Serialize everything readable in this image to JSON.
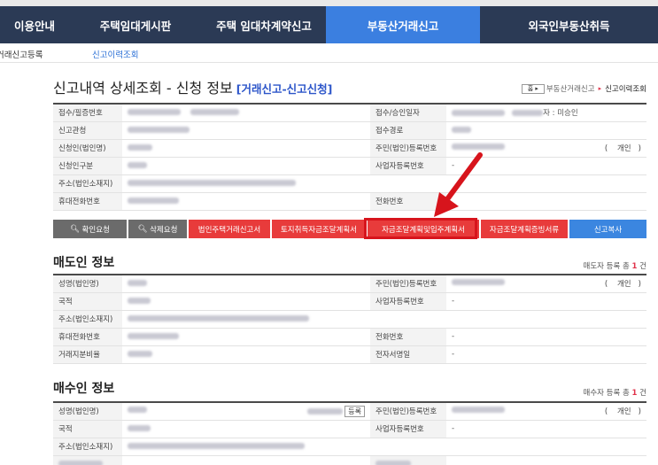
{
  "gnb": [
    {
      "label": "이용안내"
    },
    {
      "label": "주택임대게시판"
    },
    {
      "label": "주택 임대차계약신고"
    },
    {
      "label": "부동산거래신고"
    },
    {
      "label": "외국인부동산취득"
    }
  ],
  "subnav": {
    "item1": "거래신고등록",
    "item2": "신고이력조회"
  },
  "page": {
    "title": "신고내역 상세조회 - 신청 정보",
    "title_accent": "[거래신고-신고신청]"
  },
  "breadcrumb": {
    "home": "홈",
    "parent": "부동산거래신고",
    "current": "신고이력조회"
  },
  "application": {
    "receipt_no_label": "접수/필증번호",
    "receipt_date_label": "접수/승인일자",
    "approval_suffix": "자 : 미승인",
    "office_label": "신고관청",
    "route_label": "접수경로",
    "applicant_label": "신청인(법인명)",
    "rrn_label": "주민(법인)등록번호",
    "person_type": "개인",
    "applicant_type_label": "신청인구분",
    "bizno_label": "사업자등록번호",
    "bizno_value": "-",
    "address_label": "주소(법인소재지)",
    "mobile_label": "휴대전화번호",
    "phone_label": "전화번호"
  },
  "buttons": {
    "confirm": "확인요청",
    "delete": "삭제요청",
    "corp_house": "법인주택거래신고서",
    "land_fund": "토지취득자금조달계획서",
    "fund_plan": "자금조달계획및입주계획서",
    "fund_proof": "자금조달계획증빙서류",
    "copy": "신고복사"
  },
  "seller": {
    "heading": "매도인 정보",
    "count_prefix": "매도자 등록 총",
    "count": "1",
    "count_suffix": "건",
    "name_label": "성명(법인명)",
    "rrn_label": "주민(법인)등록번호",
    "person_type": "개인",
    "nation_label": "국적",
    "bizno_label": "사업자등록번호",
    "bizno_value": "-",
    "address_label": "주소(법인소재지)",
    "mobile_label": "휴대전화번호",
    "phone_label": "전화번호",
    "phone_value": "-",
    "share_label": "거래지분비율",
    "esign_label": "전자서명일",
    "esign_value": "-"
  },
  "buyer": {
    "heading": "매수인 정보",
    "count_prefix": "매수자 등록 총",
    "count": "1",
    "count_suffix": "건",
    "name_label": "성명(법인명)",
    "register_button": "등록",
    "rrn_label": "주민(법인)등록번호",
    "person_type": "개인",
    "nation_label": "국적",
    "bizno_label": "사업자등록번호",
    "bizno_value": "-",
    "address_label": "주소(법인소재지)"
  },
  "colors": {
    "nav_bg": "#2b3a55",
    "nav_active": "#3b7fe0",
    "red_button": "#e83b3b",
    "annotation": "#d7141c"
  }
}
